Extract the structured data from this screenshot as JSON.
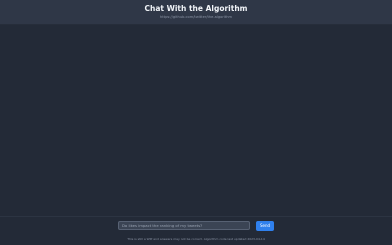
{
  "header": {
    "title": "Chat With the Algorithm",
    "repo_url": "https://github.com/twitter/the-algorithm"
  },
  "composer": {
    "input_value": "",
    "input_placeholder": "Do likes impact the ranking of my tweets?",
    "send_label": "Send"
  },
  "footer": {
    "disclaimer": "This is still a WIP and answers may not be correct. Algorithm code last updated 2023-04-14"
  },
  "colors": {
    "background": "#232a37",
    "header_background": "#2f3747",
    "accent": "#2f80ed"
  }
}
